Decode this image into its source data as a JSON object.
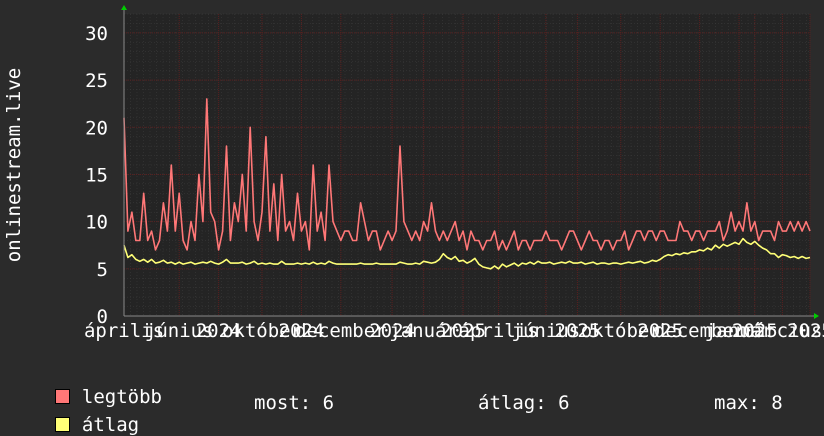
{
  "colors": {
    "background": "#2b2b2b",
    "plot_background": "#242424",
    "grid_minor": "#3e3e3e",
    "grid_major": "#5a1f1f",
    "axis": "#8a8a8a",
    "text": "#ffffff",
    "max_series": "#ff7777",
    "avg_series": "#ffff77",
    "arrow": "#00cc00"
  },
  "chart_data": {
    "type": "line",
    "ylabel": "onlinestream.live",
    "ylim": [
      0,
      32
    ],
    "yticks": [
      0,
      5,
      10,
      15,
      20,
      25,
      30
    ],
    "x_index_range": [
      0,
      174
    ],
    "grid": true,
    "x_tick_labels": [
      {
        "label": "április",
        "index": 0
      },
      {
        "label": "június",
        "index": 14
      },
      {
        "label": "2024",
        "index": 24
      },
      {
        "label": "október",
        "index": 35
      },
      {
        "label": "2024",
        "index": 45
      },
      {
        "label": "december",
        "index": 55
      },
      {
        "label": "2024",
        "index": 68
      },
      {
        "label": "január",
        "index": 76
      },
      {
        "label": "2025",
        "index": 86
      },
      {
        "label": "április",
        "index": 95
      },
      {
        "label": "június",
        "index": 107
      },
      {
        "label": "2025",
        "index": 115
      },
      {
        "label": "október",
        "index": 126
      },
      {
        "label": "2025",
        "index": 136
      },
      {
        "label": "december",
        "index": 146
      },
      {
        "label": "január",
        "index": 156
      },
      {
        "label": "2025",
        "index": 160
      },
      {
        "label": "március",
        "index": 167
      },
      {
        "label": "2025",
        "index": 174
      }
    ],
    "series": [
      {
        "name": "legtöbb",
        "color": "#ff7777",
        "values": [
          21,
          9,
          11,
          8,
          8,
          13,
          8,
          9,
          7,
          8,
          12,
          9,
          16,
          9,
          13,
          8,
          7,
          10,
          8,
          15,
          10,
          23,
          11,
          10,
          7,
          9,
          18,
          8,
          12,
          10,
          15,
          9,
          20,
          10,
          8,
          11,
          19,
          9,
          14,
          8,
          15,
          9,
          10,
          8,
          13,
          9,
          10,
          7,
          16,
          9,
          11,
          8,
          16,
          10,
          9,
          8,
          9,
          9,
          8,
          8,
          12,
          10,
          8,
          9,
          9,
          7,
          8,
          9,
          8,
          9,
          18,
          10,
          9,
          8,
          9,
          8,
          10,
          9,
          12,
          9,
          8,
          9,
          8,
          9,
          10,
          8,
          9,
          7,
          9,
          8,
          8,
          7,
          8,
          8,
          9,
          7,
          8,
          7,
          8,
          9,
          7,
          8,
          8,
          7,
          8,
          8,
          8,
          9,
          8,
          8,
          8,
          7,
          8,
          9,
          9,
          8,
          7,
          8,
          9,
          8,
          8,
          7,
          8,
          8,
          7,
          8,
          8,
          9,
          7,
          8,
          9,
          9,
          8,
          9,
          9,
          8,
          9,
          9,
          8,
          8,
          8,
          10,
          9,
          9,
          8,
          9,
          9,
          8,
          9,
          9,
          9,
          10,
          8,
          9,
          11,
          9,
          10,
          9,
          12,
          9,
          10,
          8,
          9,
          9,
          9,
          8,
          10,
          9,
          9,
          10,
          9,
          10,
          9,
          10,
          9
        ],
        "label_color": "#ff7777"
      },
      {
        "name": "átlag",
        "color": "#ffff77",
        "values": [
          7.5,
          6.2,
          6.5,
          6.0,
          5.8,
          6.0,
          5.7,
          6.0,
          5.6,
          5.7,
          5.9,
          5.6,
          5.7,
          5.5,
          5.7,
          5.5,
          5.6,
          5.7,
          5.5,
          5.6,
          5.7,
          5.6,
          5.8,
          5.6,
          5.5,
          5.7,
          6.0,
          5.6,
          5.6,
          5.6,
          5.7,
          5.5,
          5.6,
          5.8,
          5.5,
          5.6,
          5.5,
          5.6,
          5.5,
          5.5,
          5.8,
          5.5,
          5.5,
          5.5,
          5.6,
          5.5,
          5.6,
          5.5,
          5.7,
          5.5,
          5.6,
          5.5,
          5.8,
          5.6,
          5.5,
          5.5,
          5.5,
          5.5,
          5.5,
          5.5,
          5.6,
          5.5,
          5.5,
          5.5,
          5.6,
          5.5,
          5.5,
          5.5,
          5.5,
          5.5,
          5.7,
          5.6,
          5.5,
          5.5,
          5.6,
          5.5,
          5.8,
          5.7,
          5.6,
          5.7,
          6.0,
          6.6,
          6.2,
          6.0,
          6.3,
          5.8,
          5.9,
          5.6,
          5.8,
          6.1,
          5.5,
          5.2,
          5.1,
          5.0,
          5.3,
          5.0,
          5.5,
          5.2,
          5.4,
          5.6,
          5.3,
          5.6,
          5.5,
          5.7,
          5.5,
          5.8,
          5.6,
          5.6,
          5.7,
          5.5,
          5.6,
          5.7,
          5.6,
          5.8,
          5.6,
          5.6,
          5.7,
          5.5,
          5.6,
          5.7,
          5.5,
          5.6,
          5.6,
          5.5,
          5.6,
          5.6,
          5.5,
          5.6,
          5.7,
          5.6,
          5.7,
          5.8,
          5.6,
          5.7,
          5.9,
          5.8,
          6.0,
          6.3,
          6.5,
          6.4,
          6.6,
          6.5,
          6.7,
          6.6,
          6.8,
          6.8,
          7.0,
          6.9,
          7.2,
          7.0,
          7.5,
          7.2,
          7.6,
          7.4,
          7.6,
          7.8,
          7.6,
          8.2,
          7.8,
          7.6,
          7.9,
          7.5,
          7.2,
          7.0,
          6.6,
          6.6,
          6.2,
          6.5,
          6.4,
          6.2,
          6.3,
          6.1,
          6.3,
          6.1,
          6.2
        ],
        "label_color": "#ffff77"
      }
    ]
  },
  "legend": {
    "max_label": "legtöbb",
    "avg_label": "átlag"
  },
  "stats": {
    "now": "most: 6",
    "avg": "átlag: 6",
    "max": "max: 8"
  }
}
